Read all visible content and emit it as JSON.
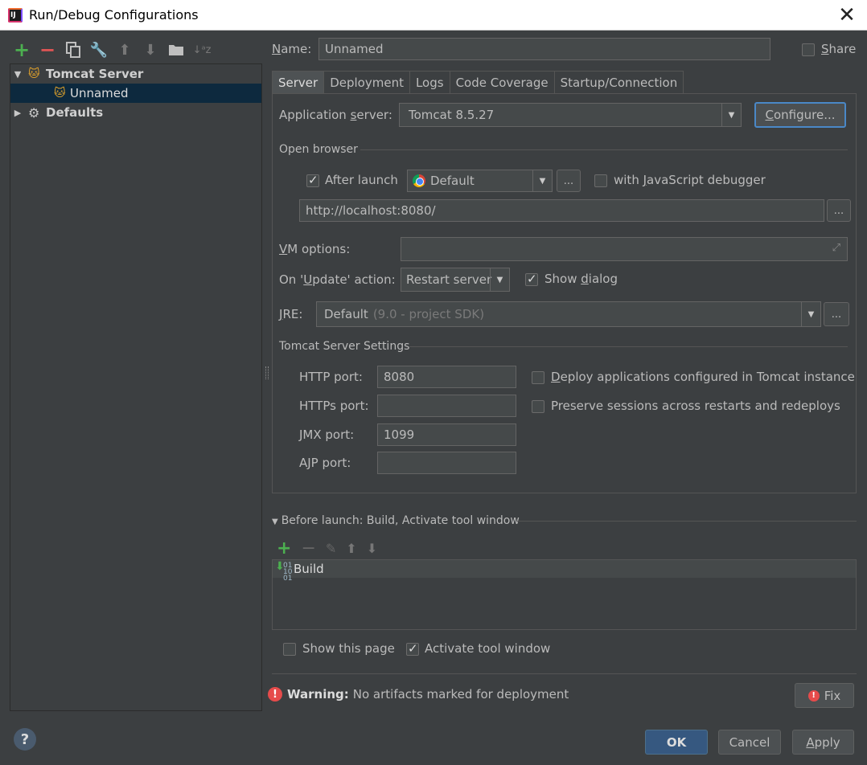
{
  "window": {
    "title": "Run/Debug Configurations",
    "close_icon": "close-icon"
  },
  "left_toolbar": {
    "icons": [
      "add-icon",
      "remove-icon",
      "copy-icon",
      "wrench-icon",
      "move-up-icon",
      "move-down-icon",
      "folder-icon",
      "sort-icon"
    ]
  },
  "tree": {
    "items": [
      {
        "label": "Tomcat Server",
        "expanded": true
      },
      {
        "label": "Unnamed",
        "selected": true
      },
      {
        "label": "Defaults",
        "expanded": false
      }
    ]
  },
  "config": {
    "name_label": "Name:",
    "name_value": "Unnamed",
    "share_label": "Share"
  },
  "tabs": [
    "Server",
    "Deployment",
    "Logs",
    "Code Coverage",
    "Startup/Connection"
  ],
  "server": {
    "app_server_label": "Application server:",
    "app_server_value": "Tomcat 8.5.27",
    "configure_label": "Configure...",
    "open_browser_label": "Open browser",
    "after_launch_label": "After launch",
    "browser_value": "Default",
    "dots_label": "...",
    "js_debugger_label": "with JavaScript debugger",
    "url_value": "http://localhost:8080/",
    "vm_options_label": "VM options:",
    "on_update_label": "On 'Update' action:",
    "on_update_value": "Restart server",
    "show_dialog_label": "Show dialog",
    "jre_label": "JRE:",
    "jre_value": "Default",
    "jre_hint": "(9.0 - project SDK)",
    "tomcat_settings_label": "Tomcat Server Settings",
    "http_port_label": "HTTP port:",
    "http_port_value": "8080",
    "https_port_label": "HTTPs port:",
    "https_port_value": "",
    "jmx_port_label": "JMX port:",
    "jmx_port_value": "1099",
    "ajp_port_label": "AJP port:",
    "ajp_port_value": "",
    "deploy_apps_label": "Deploy applications configured in Tomcat instance",
    "preserve_sessions_label": "Preserve sessions across restarts and redeploys"
  },
  "before_launch": {
    "title": "Before launch: Build, Activate tool window",
    "items": [
      "Build"
    ],
    "show_page_label": "Show this page",
    "activate_label": "Activate tool window"
  },
  "warning": {
    "bold": "Warning:",
    "text": "No artifacts marked for deployment",
    "fix_label": "Fix"
  },
  "buttons": {
    "ok": "OK",
    "cancel": "Cancel",
    "apply": "Apply"
  },
  "colors": {
    "background": "#3c3f41",
    "selection": "#0d293e",
    "accent_blue": "#365880",
    "warning_red": "#e64b4b",
    "add_green": "#4caf50"
  }
}
